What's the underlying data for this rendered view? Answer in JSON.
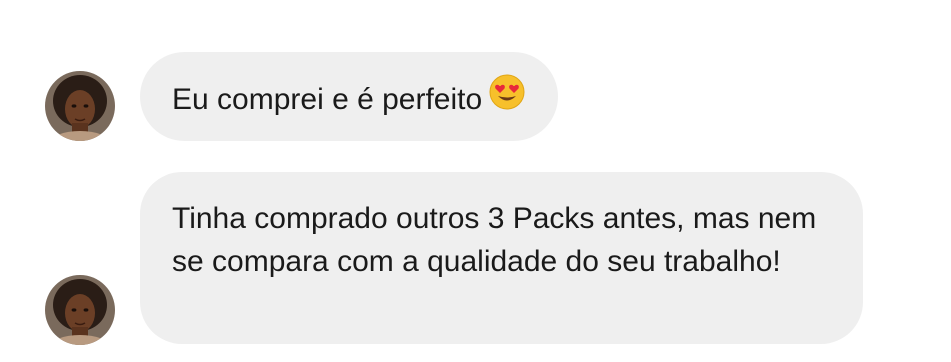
{
  "conversation": {
    "messages": [
      {
        "text": "Eu comprei e é perfeito",
        "emoji": "heart-eyes-emoji"
      },
      {
        "text": "Tinha comprado outros 3 Packs antes, mas nem se compara com a qualidade do seu trabalho!"
      }
    ]
  },
  "colors": {
    "bubble_bg": "#efefef",
    "text": "#1a1a1a",
    "background": "#ffffff"
  }
}
